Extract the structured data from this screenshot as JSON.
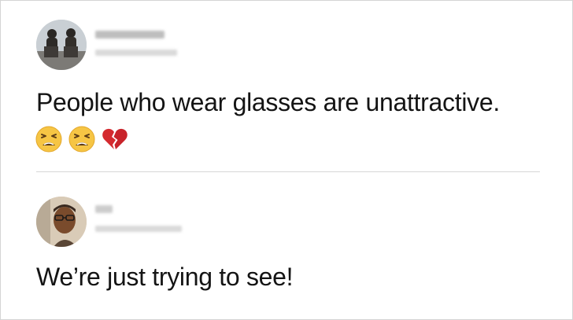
{
  "tweets": [
    {
      "text": "People who wear glasses are unattractive.",
      "emojis": [
        "tired-face-emoji",
        "tired-face-emoji",
        "broken-heart-emoji"
      ],
      "colors": {
        "emoji_face": "#f6c544",
        "broken_heart": "#d42a2f"
      }
    },
    {
      "text": "We’re just trying to see!"
    }
  ],
  "colors": {
    "text": "#141414",
    "divider": "#d6d6d6",
    "frame_border": "#d4d4d4",
    "blurred_name": "#c9c9c9"
  }
}
